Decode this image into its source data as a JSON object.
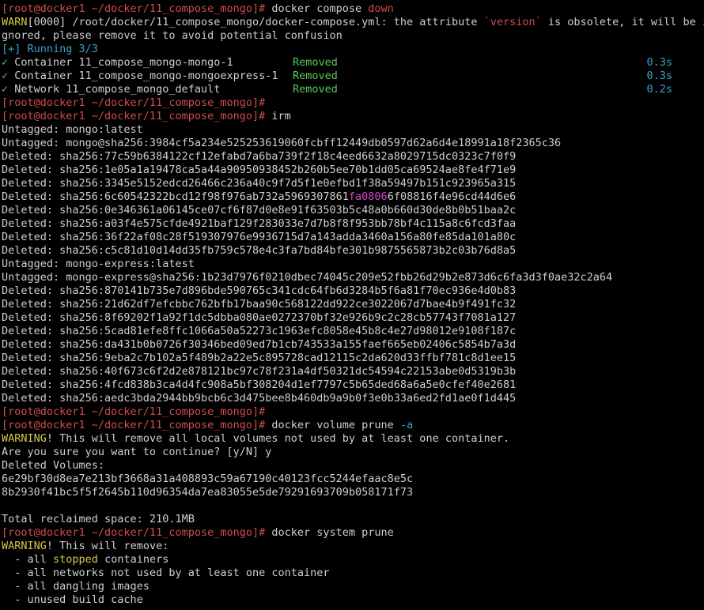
{
  "prompt": "[root@docker1 ~/docker/11_compose_mongo]#",
  "cmd1": " docker compose ",
  "cmd1_arg": "down",
  "warn_prefix": "WARN",
  "warn_line1": "[0000] /root/docker/11_compose_mongo/docker-compose.yml: the attribute ",
  "warn_attr": "`version`",
  "warn_line1b": " is obsolete, it will be i",
  "warn_line2": "gnored, please remove it to avoid potential confusion",
  "running": "[+] Running 3/3",
  "compose_items": [
    {
      "check": "✓",
      "label": " Container 11_compose_mongo-mongo-1",
      "status": "Removed",
      "time": "0.3s"
    },
    {
      "check": "✓",
      "label": " Container 11_compose_mongo-mongoexpress-1",
      "status": "Removed",
      "time": "0.3s"
    },
    {
      "check": "✓",
      "label": " Network 11_compose_mongo_default",
      "status": "Removed",
      "time": "0.2s"
    }
  ],
  "cmd2": " irm",
  "irm_lines": [
    "Untagged: mongo:latest",
    "Untagged: mongo@sha256:3984cf5a234e525253619060fcbff12449db0597d62a6d4e18991a18f2365c36",
    "Deleted: sha256:77c59b6384122cf12efabd7a6ba739f2f18c4eed6632a8029715dc0323c7f0f9",
    "Deleted: sha256:1e05a1a19478ca5a44a90950938452b260b5ee70b1dd05ca69524ae8fe4f71e9",
    "Deleted: sha256:3345e5152edcd26466c236a40c9f7d5f1e0efbd1f38a59497b151c923965a315"
  ],
  "irm_mag_prefix": "Deleted: sha256:6c60542322bcd12f98f976ab732a5969307861",
  "irm_mag_mid": "fa0806",
  "irm_mag_suffix": "6f08816f4e96cd44d6e6",
  "irm_lines2": [
    "Deleted: sha256:0e346361a06145ce07cf6f87d0e8e91f63503b5c48a0b660d30de8b0b51baa2c",
    "Deleted: sha256:a03f4e575cfde4921baf129f283033e7d7b8f8f953bb78bf4c115a8c6fcd3faa",
    "Deleted: sha256:36f22af08c28f519307976e9936715d7a143adda3460a156a80fe85da101a80c",
    "Deleted: sha256:c5c81d10d14dd35fb759c578e4c3fa7bd84bfe301b9875565873b2c03b76d8a5",
    "Untagged: mongo-express:latest",
    "Untagged: mongo-express@sha256:1b23d7976f0210dbec74045c209e52fbb26d29b2e873d6c6fa3d3f0ae32c2a64",
    "Deleted: sha256:870141b735e7d896bde590765c341cdc64fb6d3284b5f6a81f70ec936e4d0b83",
    "Deleted: sha256:21d62df7efcbbc762bfb17baa90c568122dd922ce3022067d7bae4b9f491fc32",
    "Deleted: sha256:8f69202f1a92f1dc5dbba080ae0272370bf32e926b9c2c28cb57743f7081a127",
    "Deleted: sha256:5cad81efe8ffc1066a50a52273c1963efc8058e45b8c4e27d98012e9108f187c",
    "Deleted: sha256:da431b0b0726f30346bed09ed7b1cb743533a155faef665eb02406c5854b7a3d",
    "Deleted: sha256:9eba2c7b102a5f489b2a22e5c895728cad12115c2da620d33ffbf781c8d1ee15",
    "Deleted: sha256:40f673c6f2d2e878121bc97c78f231a4df50321dc54594c22153abe0d5319b3b",
    "Deleted: sha256:4fcd838b3ca4d4fc908a5bf308204d1ef7797c5b65ded68a6a5e0cfef40e2681",
    "Deleted: sha256:aedc3bda2944bb9bcb6c3d475bee8b460db9a9b0f3e0b33a6ed2fd1ae0f1d445"
  ],
  "cmd3": " docker volume prune ",
  "cmd3_flag": "-a",
  "vol_warn_prefix": "WARNING",
  "vol_warn_text": "! This will remove all local volumes not used by at least one container.",
  "vol_confirm": "Are you sure you want to continue? [y/N] y",
  "vol_deleted_header": "Deleted Volumes:",
  "vol_ids": [
    "6e29bf30d8ea7e213bf3668a31a408893c59a67190c40123fcc5244efaac8e5c",
    "8b2930f41bc5f5f2645b110d96354da7ea83055e5de79291693709b058171f73"
  ],
  "vol_blank": " ",
  "reclaimed": "Total reclaimed space: 210.1MB",
  "cmd4": " docker system prune",
  "sys_warn_prefix": "WARNING",
  "sys_warn_text": "! This will remove:",
  "sys_item1_pre": "  - all ",
  "sys_item1_hl": "stopped",
  "sys_item1_post": " containers",
  "sys_items": [
    "  - all networks not used by at least one container",
    "  - all dangling images",
    "  - unused build cache"
  ],
  "colors": {
    "background": "#000000",
    "text": "#cfcfcf",
    "prompt": "#d14c4c",
    "warn": "#d4c84a",
    "info": "#3aa0c8",
    "success": "#5ac85a",
    "highlight": "#d04ad0"
  }
}
